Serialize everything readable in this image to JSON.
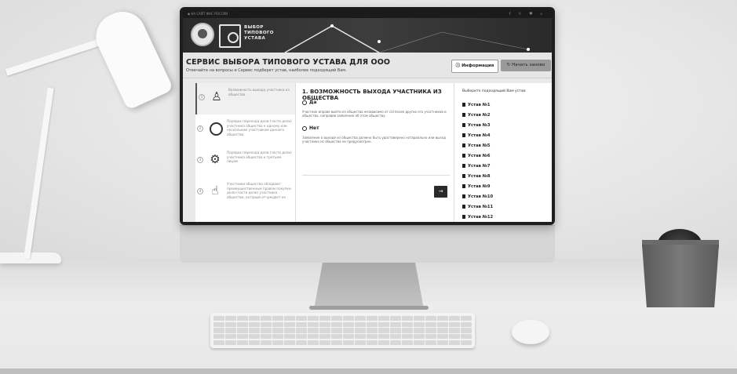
{
  "topbar": {
    "link": "◆ НА САЙТ ФНС РОССИИ",
    "social": "f ☼ ♥ ⌕"
  },
  "logo": {
    "text": "ВЫБОР\nТИПОВОГО\nУСТАВА"
  },
  "page": {
    "title": "СЕРВИС ВЫБОРА ТИПОВОГО УСТАВА ДЛЯ ООО",
    "subtitle": "Отвечайте на вопросы и Сервис подберет устав, наиболее подходящий Вам."
  },
  "buttons": {
    "info": "ⓘ Информация",
    "restart": "↻ Начать заново",
    "next": "→"
  },
  "steps": [
    {
      "num": "1",
      "icon": "person-icon",
      "glyph": "♙",
      "text": "Возможность выхода участника из общества"
    },
    {
      "num": "2",
      "icon": "circle-icon",
      "glyph": "",
      "text": "Порядок перехода доли (части доли) участника общества к одному или нескольким участникам данного общества"
    },
    {
      "num": "3",
      "icon": "gear-icon",
      "glyph": "⚙",
      "text": "Порядок перехода доли (части доли) участника общества к третьим лицам"
    },
    {
      "num": "4",
      "icon": "hand-icon",
      "glyph": "☝",
      "text": "Участники общества обладают преимущественным правом покупки доли (части доли) участника общества, который отчуждает ее"
    }
  ],
  "question": {
    "title": "1. ВОЗМОЖНОСТЬ ВЫХОДА УЧАСТНИКА ИЗ ОБЩЕСТВА",
    "options": [
      {
        "label": "Да",
        "desc": "Участник вправе выйти из общества независимо от согласия других его участников и общества, направив заявление об этом обществу."
      },
      {
        "label": "Нет",
        "desc": "Заявление о выходе из общества должно быть удостоверено нотариально или выход участника из общества не предусмотрен."
      }
    ]
  },
  "charters": {
    "header": "Выберите подходящий Вам устав:",
    "items": [
      "Устав №1",
      "Устав №2",
      "Устав №3",
      "Устав №4",
      "Устав №5",
      "Устав №6",
      "Устав №7",
      "Устав №8",
      "Устав №9",
      "Устав №10",
      "Устав №11",
      "Устав №12"
    ]
  }
}
